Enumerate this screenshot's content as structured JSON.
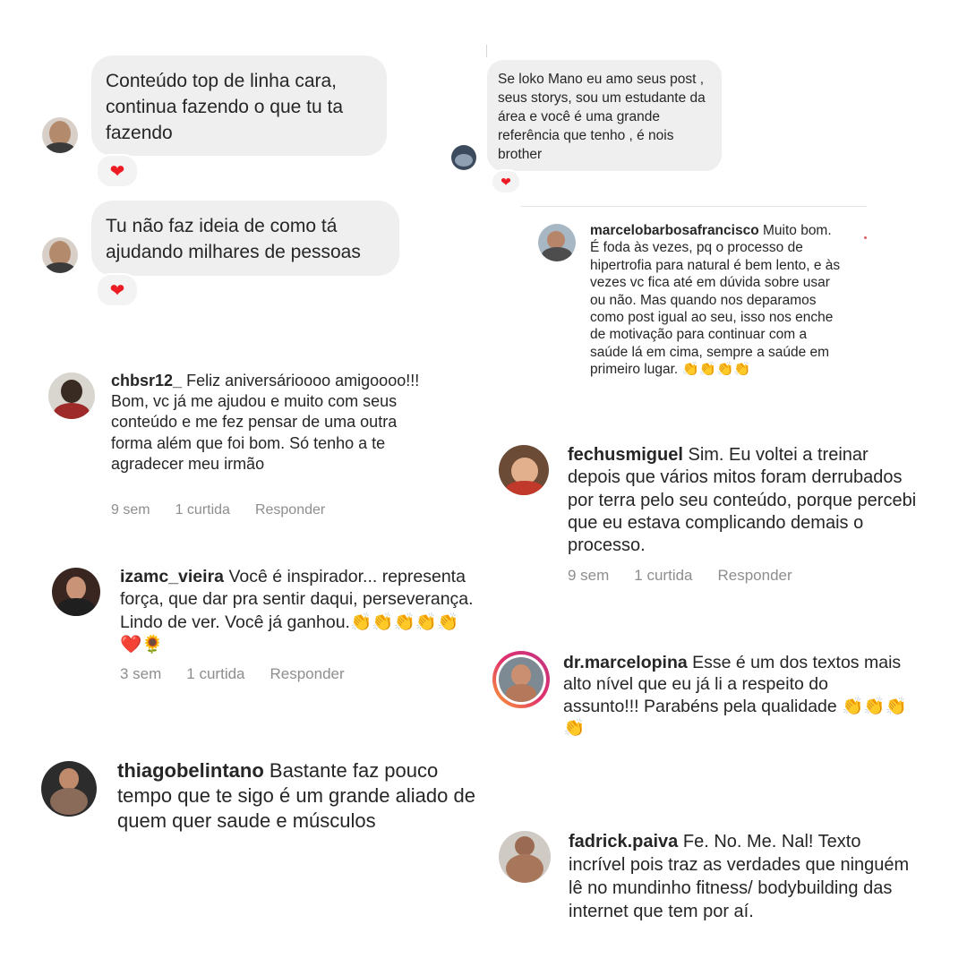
{
  "dm_bubbles": [
    {
      "text": "Conteúdo top de linha cara, continua fazendo o que tu ta fazendo",
      "heart": "❤"
    },
    {
      "text": "Tu não faz ideia de como tá ajudando milhares de pessoas",
      "heart": "❤"
    },
    {
      "text": "Se loko Mano eu amo seus post , seus storys,  sou um estudante da área e você é uma grande referência que tenho , é nois brother",
      "heart": "❤"
    }
  ],
  "comments": {
    "marcelo": {
      "username": "marcelobarbosafrancisco",
      "text": "Muito bom. É foda às vezes, pq o processo de hipertrofia para natural é bem lento, e às vezes vc fica até em dúvida sobre usar ou não. Mas quando nos deparamos como post igual ao seu, isso nos enche de motivação para continuar com a saúde lá em cima, sempre a saúde em primeiro lugar. 👏👏👏👏"
    },
    "chbsr": {
      "username": "chbsr12_",
      "text": "Feliz aniversárioooo amigoooo!!! Bom, vc já me ajudou e muito com seus conteúdo e me fez pensar de uma outra forma além que foi bom. Só tenho a te agradecer meu irmão",
      "time": "9 sem",
      "likes": "1 curtida",
      "reply": "Responder"
    },
    "fechus": {
      "username": "fechusmiguel",
      "text": "Sim. Eu voltei a treinar depois que vários mitos foram derrubados por terra pelo seu conteúdo, porque percebi que eu estava complicando demais o processo.",
      "time": "9 sem",
      "likes": "1 curtida",
      "reply": "Responder"
    },
    "izamc": {
      "username": "izamc_vieira",
      "text": "Você é inspirador... representa força, que dar pra sentir daqui,  perseverança. Lindo de ver. Você já ganhou.👏👏👏👏👏❤️🌻",
      "time": "3 sem",
      "likes": "1 curtida",
      "reply": "Responder"
    },
    "drmarcelo": {
      "username": "dr.marcelopina",
      "text": "Esse é um dos textos mais alto nível que eu já li a respeito do assunto!!! Parabéns pela qualidade 👏👏👏👏"
    },
    "thiago": {
      "username": "thiagobelintano",
      "text": "Bastante faz pouco tempo que te sigo é um grande aliado de quem quer saude e músculos"
    },
    "fadrick": {
      "username": "fadrick.paiva",
      "text": "Fe. No. Me. Nal! Texto incrível pois traz as verdades que ninguém lê no mundinho fitness/ bodybuilding das internet que tem por aí."
    }
  },
  "colors": {
    "bubble": "#efefef",
    "heart": "#ed1c24",
    "meta": "#8e8e8e",
    "story_ring": "#c13584"
  }
}
